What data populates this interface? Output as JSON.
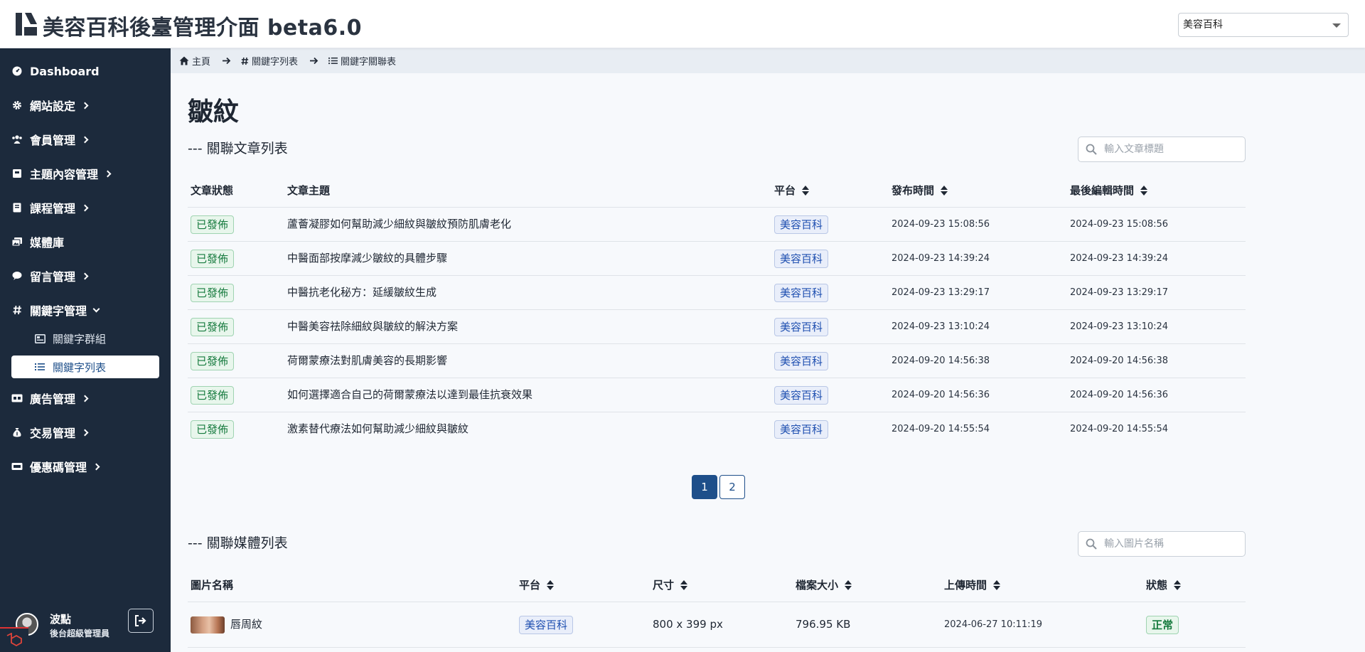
{
  "app": {
    "title": "美容百科後臺管理介面 beta6.0"
  },
  "site_select": {
    "value": "美容百科"
  },
  "sidebar": {
    "items": [
      {
        "label": "Dashboard"
      },
      {
        "label": "網站設定"
      },
      {
        "label": "會員管理"
      },
      {
        "label": "主題內容管理"
      },
      {
        "label": "課程管理"
      },
      {
        "label": "媒體庫"
      },
      {
        "label": "留言管理"
      },
      {
        "label": "關鍵字管理"
      },
      {
        "label": "廣告管理"
      },
      {
        "label": "交易管理"
      },
      {
        "label": "優惠碼管理"
      }
    ],
    "sub_items": [
      {
        "label": "關鍵字群組"
      },
      {
        "label": "關鍵字列表"
      }
    ],
    "user": {
      "name": "波點",
      "role": "後台超級管理員"
    }
  },
  "breadcrumb": {
    "home": "主頁",
    "keyword_list": "關鍵字列表",
    "relation_list": "關鍵字關聯表"
  },
  "page": {
    "title": "皺紋"
  },
  "articles": {
    "section_title": "--- 關聯文章列表",
    "search_placeholder": "輸入文章標題",
    "headers": {
      "status": "文章狀態",
      "subject": "文章主題",
      "platform": "平台",
      "published": "發布時間",
      "edited": "最後編輯時間"
    },
    "rows": [
      {
        "status": "已發佈",
        "subject": "蘆薈凝膠如何幫助減少細紋與皺紋預防肌膚老化",
        "platform": "美容百科",
        "published": "2024-09-23 15:08:56",
        "edited": "2024-09-23 15:08:56"
      },
      {
        "status": "已發佈",
        "subject": "中醫面部按摩減少皺紋的具體步驟",
        "platform": "美容百科",
        "published": "2024-09-23 14:39:24",
        "edited": "2024-09-23 14:39:24"
      },
      {
        "status": "已發佈",
        "subject": "中醫抗老化秘方：延緩皺紋生成",
        "platform": "美容百科",
        "published": "2024-09-23 13:29:17",
        "edited": "2024-09-23 13:29:17"
      },
      {
        "status": "已發佈",
        "subject": "中醫美容祛除細紋與皺紋的解決方案",
        "platform": "美容百科",
        "published": "2024-09-23 13:10:24",
        "edited": "2024-09-23 13:10:24"
      },
      {
        "status": "已發佈",
        "subject": "荷爾蒙療法對肌膚美容的長期影響",
        "platform": "美容百科",
        "published": "2024-09-20 14:56:38",
        "edited": "2024-09-20 14:56:38"
      },
      {
        "status": "已發佈",
        "subject": "如何選擇適合自己的荷爾蒙療法以達到最佳抗衰效果",
        "platform": "美容百科",
        "published": "2024-09-20 14:56:36",
        "edited": "2024-09-20 14:56:36"
      },
      {
        "status": "已發佈",
        "subject": "激素替代療法如何幫助減少細紋與皺紋",
        "platform": "美容百科",
        "published": "2024-09-20 14:55:54",
        "edited": "2024-09-20 14:55:54"
      }
    ],
    "pagination": [
      "1",
      "2"
    ]
  },
  "media": {
    "section_title": "--- 關聯媒體列表",
    "search_placeholder": "輸入圖片名稱",
    "headers": {
      "name": "圖片名稱",
      "platform": "平台",
      "size": "尺寸",
      "filesize": "檔案大小",
      "uploaded": "上傳時間",
      "status": "狀態"
    },
    "rows": [
      {
        "name": "唇周紋",
        "platform": "美容百科",
        "size": "800 x 399 px",
        "filesize": "796.95 KB",
        "uploaded": "2024-06-27 10:11:19",
        "status": "正常"
      }
    ]
  },
  "colors": {
    "sidebar_bg": "#1c2a3c",
    "accent": "#1e4f8a",
    "published_green": "#157a3d",
    "platform_blue": "#1e4fb0"
  }
}
